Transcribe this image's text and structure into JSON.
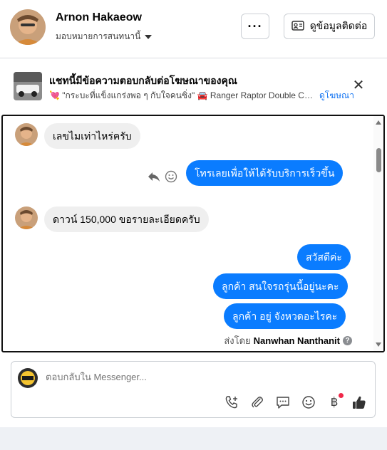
{
  "header": {
    "name": "Arnon Hakaeow",
    "assign_label": "มอบหมายการสนทนานี้",
    "more_label": "···",
    "contact_label": "ดูข้อมูลติดต่อ"
  },
  "ad": {
    "title": "แชทนี้มีข้อความตอบกลับต่อโฆษณาของคุณ",
    "subtitle": "💘 \"กระบะที่แข็งแกร่งพอ ๆ กับใจคนซิ่ง\" 🚘 Ranger Raptor Double Ca...",
    "link": "ดูโฆษณา"
  },
  "messages": [
    {
      "side": "in",
      "text": "เลขไมเท่าไหร่ครับ"
    },
    {
      "side": "out",
      "text": "โทรเลยเพื่อให้ได้รับบริการเร็วขึ้น"
    },
    {
      "side": "in",
      "text": "ดาวน์ 150,000 ขอรายละเอียดครับ"
    },
    {
      "side": "out",
      "text": "สวัสดีค่ะ"
    },
    {
      "side": "out",
      "text": "ลูกค้า สนใจรถรุ่นนี้อยู่นะคะ"
    },
    {
      "side": "out",
      "text": "ลูกค้า อยู่ จังหวดอะไรคะ"
    }
  ],
  "sent_by": {
    "prefix": "ส่งโดย",
    "agent": "Nanwhan Nanthanit"
  },
  "composer": {
    "placeholder": "ตอบกลับใน Messenger..."
  },
  "colors": {
    "accent": "#0a7cff",
    "link": "#1877f2",
    "incoming": "#efefef"
  }
}
